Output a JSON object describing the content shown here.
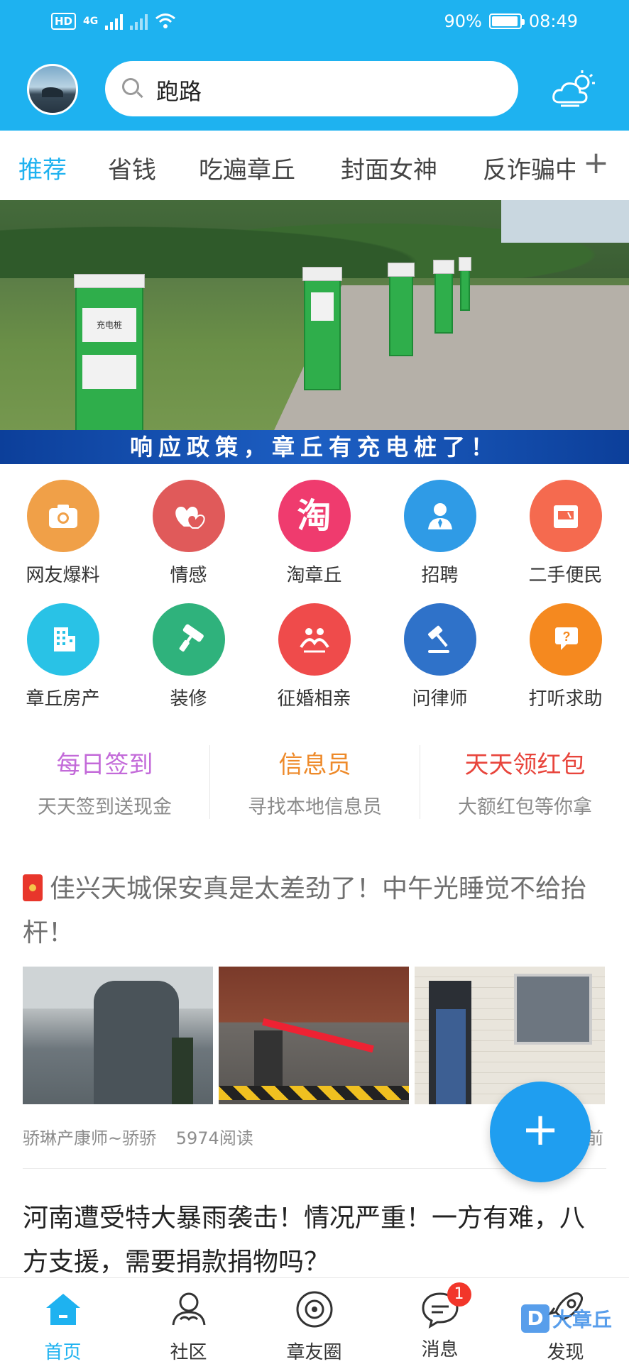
{
  "status_bar": {
    "network": "4G",
    "battery": "90%",
    "time": "08:49"
  },
  "header": {
    "search_text": "跑路"
  },
  "tabs": [
    {
      "label": "推荐",
      "active": true
    },
    {
      "label": "省钱"
    },
    {
      "label": "吃遍章丘"
    },
    {
      "label": "封面女神"
    },
    {
      "label": "反诈骗中"
    }
  ],
  "banner": {
    "caption": "响应政策，章丘有充电桩了！",
    "pole_label": "充电桩",
    "dots_count": 6,
    "active_dot": 4
  },
  "grid": [
    {
      "label": "网友爆料",
      "color": "#f0a048",
      "icon": "camera-icon"
    },
    {
      "label": "情感",
      "color": "#e05a5a",
      "icon": "hearts-icon"
    },
    {
      "label": "淘章丘",
      "color": "#ef3b6e",
      "icon": "tao-icon",
      "glyph": "淘"
    },
    {
      "label": "招聘",
      "color": "#2f9be6",
      "icon": "person-tie-icon"
    },
    {
      "label": "二手便民",
      "color": "#f56a4f",
      "icon": "shop-icon"
    },
    {
      "label": "章丘房产",
      "color": "#29c2e6",
      "icon": "building-icon"
    },
    {
      "label": "装修",
      "color": "#2fb27c",
      "icon": "paint-roller-icon"
    },
    {
      "label": "征婚相亲",
      "color": "#ef4b4b",
      "icon": "couple-icon"
    },
    {
      "label": "问律师",
      "color": "#2f72c9",
      "icon": "gavel-icon"
    },
    {
      "label": "打听求助",
      "color": "#f5891f",
      "icon": "help-chat-icon"
    }
  ],
  "promos": [
    {
      "title": "每日签到",
      "subtitle": "天天签到送现金",
      "color": "#c36ad9"
    },
    {
      "title": "信息员",
      "subtitle": "寻找本地信息员",
      "color": "#ee8a2a"
    },
    {
      "title": "天天领红包",
      "subtitle": "大额红包等你拿",
      "color": "#e8453c"
    }
  ],
  "article1": {
    "title": "佳兴天城保安真是太差劲了！中午光睡觉不给抬杆！",
    "author": "骄琳产康师~骄骄",
    "reads": "5974阅读",
    "time_suffix": "前"
  },
  "article2": {
    "title": "河南遭受特大暴雨袭击！情况严重！一方有难，八方支援，需要捐款捐物吗？"
  },
  "fab": {
    "label": "+"
  },
  "bottom_nav": [
    {
      "label": "首页",
      "icon": "home-icon",
      "active": true
    },
    {
      "label": "社区",
      "icon": "community-icon"
    },
    {
      "label": "章友圈",
      "icon": "circle-icon"
    },
    {
      "label": "消息",
      "icon": "message-icon",
      "badge": "1"
    },
    {
      "label": "发现",
      "icon": "rocket-icon"
    }
  ],
  "watermark": {
    "text": "大章丘",
    "logo_letter": "D"
  },
  "colors": {
    "primary": "#1eb2f0",
    "fab": "#1f9ef0",
    "badge": "#f2362a"
  }
}
